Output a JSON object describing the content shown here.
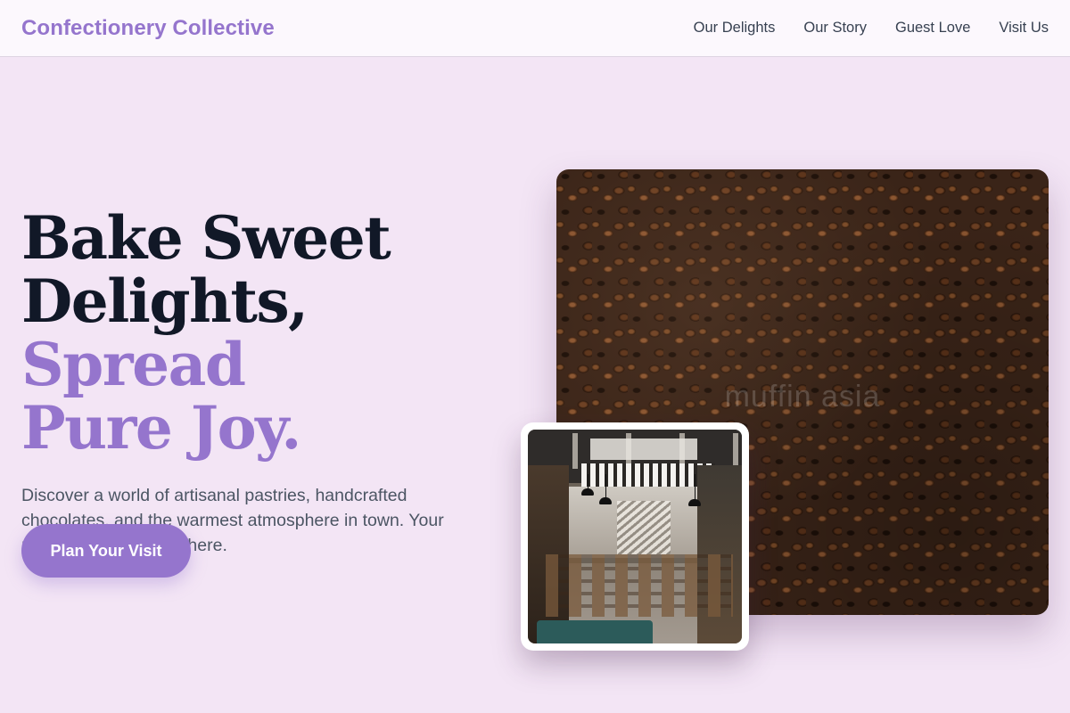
{
  "header": {
    "brand": "Confectionery Collective",
    "nav": [
      {
        "label": "Our Delights"
      },
      {
        "label": "Our Story"
      },
      {
        "label": "Guest Love"
      },
      {
        "label": "Visit Us"
      }
    ]
  },
  "hero": {
    "headline_line1": "Bake Sweet",
    "headline_line2_dark": "Delights,",
    "headline_line2_accent": "Spread",
    "headline_line3_accent": "Pure Joy.",
    "subtext": "Discover a world of artisanal pastries, handcrafted chocolates, and the warmest atmosphere in town. Your perfect escape starts here.",
    "cta_label": "Plan Your Visit"
  },
  "images": {
    "main_photo": "coffee-beans-photo",
    "main_watermark": "muffin asia",
    "inset_photo": "cafe-interior-photo"
  },
  "colors": {
    "background": "#f3e5f5",
    "accent": "#9575cd",
    "headline": "#111827",
    "body_text": "#4b5563"
  }
}
